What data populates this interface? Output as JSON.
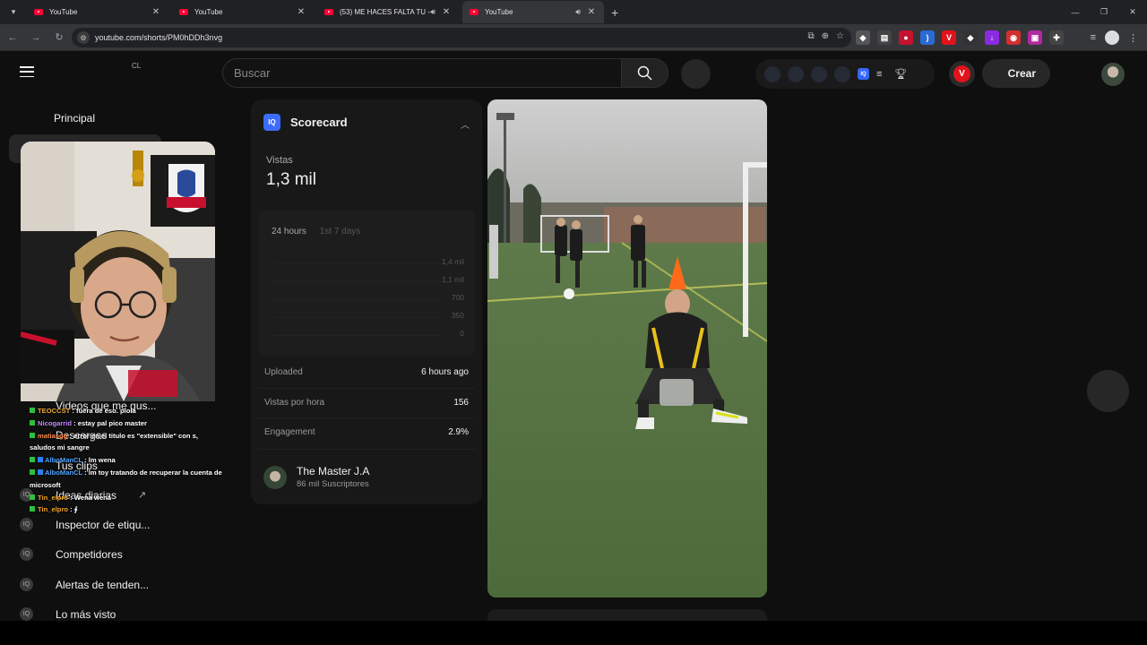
{
  "browser": {
    "tabs": [
      {
        "title": "YouTube",
        "active": false,
        "audio": false
      },
      {
        "title": "YouTube",
        "active": false,
        "audio": false
      },
      {
        "title": "(53) ME HACES FALTA TU - ",
        "active": false,
        "audio": true
      },
      {
        "title": "YouTube",
        "active": true,
        "audio": true
      }
    ],
    "url": "youtube.com/shorts/PM0hDDh3nvg"
  },
  "header": {
    "country": "CL",
    "search_placeholder": "Buscar",
    "create_label": "Crear",
    "vidiq_letter": "V"
  },
  "sidebar": {
    "section_title": "Principal",
    "items": [
      {
        "label": "Videos que me gus...",
        "icon": "thumb-icon"
      },
      {
        "label": "Descargas",
        "icon": "download-icon"
      },
      {
        "label": "Tus clips",
        "icon": "scissors-icon"
      },
      {
        "label": "Ideas diarias",
        "icon": "vidiq-icon",
        "external": true
      },
      {
        "label": "Inspector de etiqu...",
        "icon": "vidiq-icon"
      },
      {
        "label": "Competidores",
        "icon": "vidiq-icon"
      },
      {
        "label": "Alertas de tenden...",
        "icon": "vidiq-icon"
      },
      {
        "label": "Lo más visto",
        "icon": "vidiq-icon"
      }
    ]
  },
  "chat": [
    {
      "user": "TEOCCST",
      "msg": ": fuera de eso. piola"
    },
    {
      "user": "Nicogarrid",
      "msg": ": estay pal pico master"
    },
    {
      "user": "matiasgg",
      "msg": ": error en el titulo es \"extensible\" con s, saludos mi sangre"
    },
    {
      "user": "AlboManCL",
      "msg": ": lm wena"
    },
    {
      "user": "AlboManCL",
      "msg": ": lm toy tratando de recuperar la cuenta de microsoft"
    },
    {
      "user": "Tin_elpro",
      "msg": ": Wena wena"
    },
    {
      "user": "Tin_elpro",
      "msg": ": ∮"
    }
  ],
  "scorecard": {
    "title": "Scorecard",
    "views_label": "Vistas",
    "views_value": "1,3 mil",
    "range_tabs": [
      "24 hours",
      "1st 7 days"
    ],
    "y_labels": [
      "1,4 mil",
      "1,1 mil",
      "700",
      "350",
      "0"
    ],
    "rows": [
      {
        "label": "Uploaded",
        "value": "6 hours ago"
      },
      {
        "label": "Vistas por hora",
        "value": "156"
      },
      {
        "label": "Engagement",
        "value": "2.9%"
      }
    ],
    "channel_name": "The Master J.A",
    "channel_subs": "86 mil Suscriptores"
  }
}
